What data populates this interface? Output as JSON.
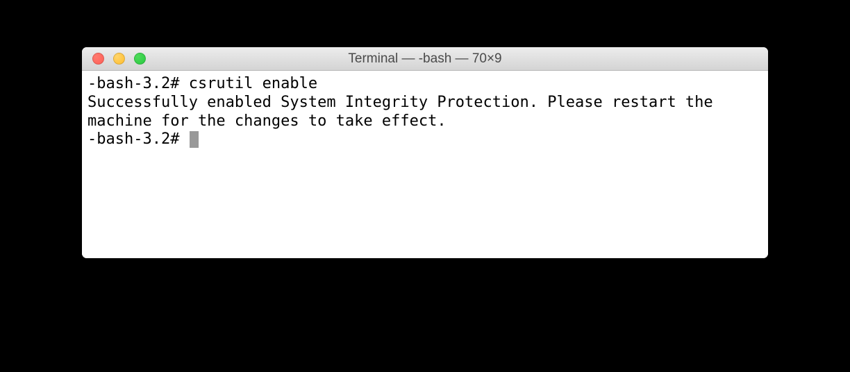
{
  "window": {
    "title": "Terminal — -bash — 70×9"
  },
  "terminal": {
    "line1": "-bash-3.2# csrutil enable",
    "line2": "Successfully enabled System Integrity Protection. Please restart the machine for the changes to take effect.",
    "prompt": "-bash-3.2# "
  }
}
